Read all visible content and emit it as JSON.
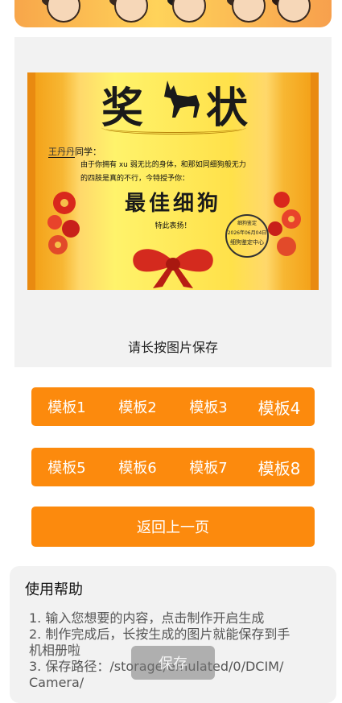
{
  "certificate": {
    "title_left": "奖",
    "title_right": "状",
    "student_name": "王丹丹",
    "student_suffix": "同学：",
    "body_line1": "由于你拥有 xu 弱无比的身体，和那如同细狗般无力",
    "body_line2": "的四肢是真的不行，今特授予你：",
    "award": "最佳细狗",
    "praise": "特此表扬！",
    "stamp_top": "细狗鉴定",
    "stamp_date": "2026年06月04日",
    "stamp_org": "细狗鉴定中心"
  },
  "caption": "请长按图片保存",
  "templates_row1": [
    "模板1",
    "模板2",
    "模板3",
    "模板4"
  ],
  "templates_row2": [
    "模板5",
    "模板6",
    "模板7",
    "模板8"
  ],
  "back_label": "返回上一页",
  "help": {
    "title": "使用帮助",
    "line1": "1. 输入您想要的内容，点击制作开启生成",
    "line2": "2. 制作完成后，长按生成的图片就能保存到手",
    "line3": "机相册啦",
    "line4": "3. 保存路径：/storage/emulated/0/DCIM/",
    "line5": "Camera/"
  },
  "toast": "保存",
  "colors": {
    "accent": "#fc8a0d",
    "panel": "#f2f2f2"
  }
}
